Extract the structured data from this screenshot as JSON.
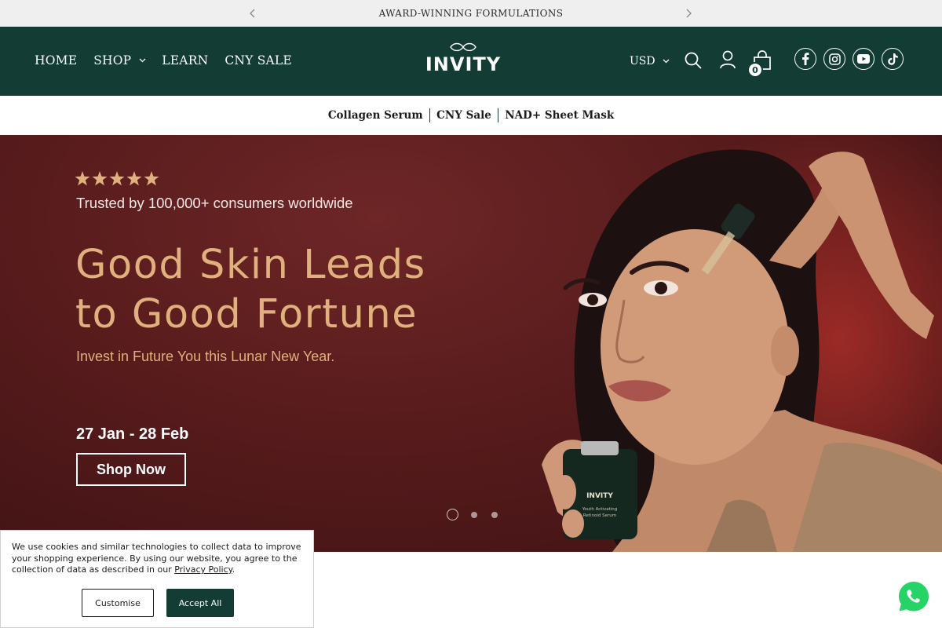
{
  "announcement": {
    "text": "AWARD-WINNING FORMULATIONS"
  },
  "nav": {
    "home": "HOME",
    "shop": "SHOP",
    "learn": "LEARN",
    "cny_sale": "CNY SALE"
  },
  "brand": {
    "name": "INVITY"
  },
  "currency": {
    "selected": "USD"
  },
  "cart": {
    "count": "0"
  },
  "subnav": {
    "items": [
      "Collagen Serum",
      "CNY Sale",
      "NAD+ Sheet Mask"
    ]
  },
  "hero": {
    "rating_stars": 5,
    "trusted": "Trusted by 100,000+ consumers worldwide",
    "headline_line1": "Good Skin Leads",
    "headline_line2": "to Good Fortune",
    "subline": "Invest in Future You this Lunar New Year.",
    "dates": "27 Jan - 28 Feb",
    "cta": "Shop Now",
    "slides": 3,
    "active_slide": 1,
    "bottle_brand": "INVITY",
    "bottle_label": "Youth Activating Retinoid Serum"
  },
  "cookie": {
    "text": "We use cookies and similar technologies to collect data to improve your shopping experience. By using our website, you agree to the collection of data as described in our ",
    "link": "Privacy Policy",
    "end": ".",
    "customise": "Customise",
    "accept": "Accept All"
  },
  "colors": {
    "header_bg": "#123c34",
    "hero_bg": "#5a1c1d",
    "headline_gold": "#e0b07d",
    "whatsapp_green": "#25d366"
  }
}
